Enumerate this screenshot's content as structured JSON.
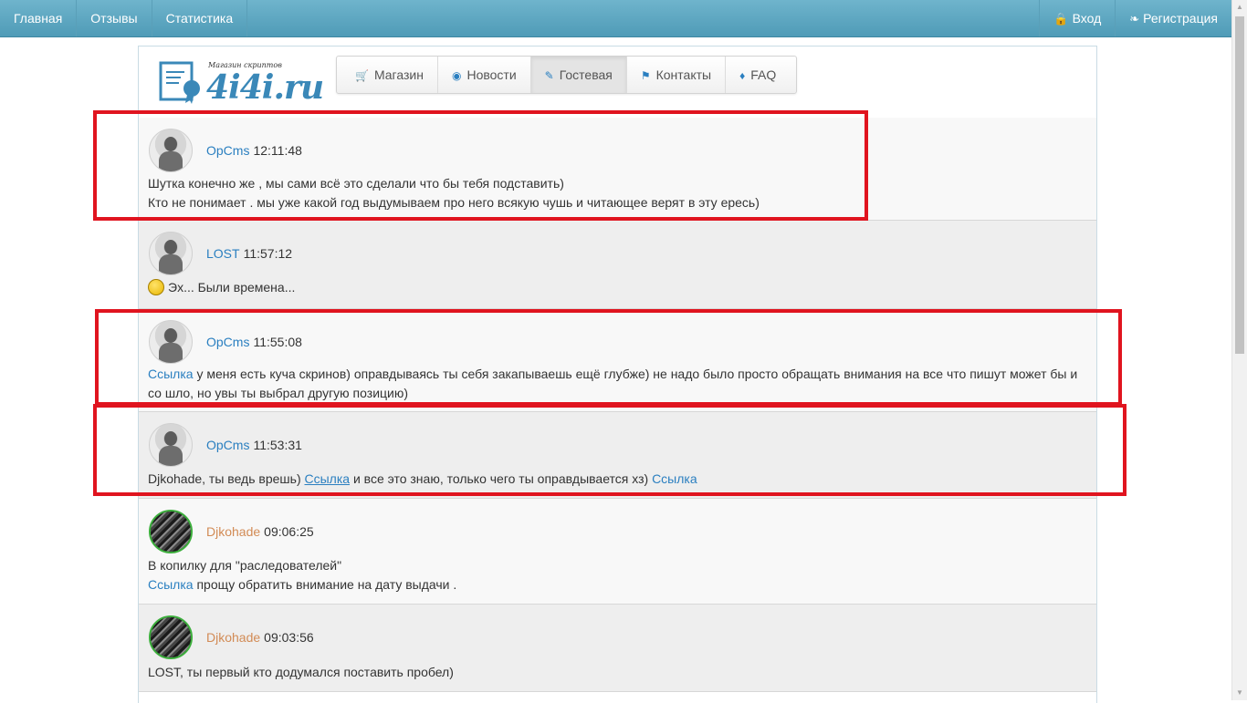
{
  "topnav": {
    "left": [
      "Главная",
      "Отзывы",
      "Статистика"
    ],
    "login": "Вход",
    "register": "Регистрация"
  },
  "logo": {
    "tagline": "Магазин скриптов",
    "name": "4i4i.ru"
  },
  "menu": [
    {
      "icon": "cart-icon",
      "label": "Магазин"
    },
    {
      "icon": "globe-icon",
      "label": "Новости"
    },
    {
      "icon": "pencil-icon",
      "label": "Гостевая",
      "active": true
    },
    {
      "icon": "bookmark-icon",
      "label": "Контакты"
    },
    {
      "icon": "tags-icon",
      "label": "FAQ"
    }
  ],
  "posts": [
    {
      "author": "OpCms",
      "time": "12:11:48",
      "line1": "Шутка конечно же , мы сами всё это сделали что бы тебя подставить)",
      "line2": "Кто не понимает . мы уже какой год выдумываем про него всякую чушь и читающее верят в эту ересь)"
    },
    {
      "author": "LOST",
      "time": "11:57:12",
      "line1": "Эх... Были времена..."
    },
    {
      "author": "OpCms",
      "time": "11:55:08",
      "link": "Ссылка",
      "line1": " у меня есть куча скринов) оправдываясь ты себя закапываешь ещё глубже) не надо было просто обращать внимания на все что пишут может бы и",
      "line2": "со шло, но увы ты выбрал другую позицию)"
    },
    {
      "author": "OpCms",
      "time": "11:53:31",
      "part1": "Djkohade, ты ведь врешь) ",
      "link1": "Ссылка",
      "part2": " и все это знаю, только чего ты оправдывается хз) ",
      "link2": "Ссылка"
    },
    {
      "author": "Djkohade",
      "time": "09:06:25",
      "line1": "В копилку для \"раследователей\"",
      "link": "Ссылка",
      "line2": " прощу обратить внимание на дату выдачи ."
    },
    {
      "author": "Djkohade",
      "time": "09:03:56",
      "line1": "LOST, ты первый кто додумался поставить пробел)"
    }
  ],
  "colors": {
    "topbar": "#5aa5c0",
    "link": "#2a7fc0",
    "author_orange": "#d28b55",
    "highlight": "#e0141f"
  }
}
